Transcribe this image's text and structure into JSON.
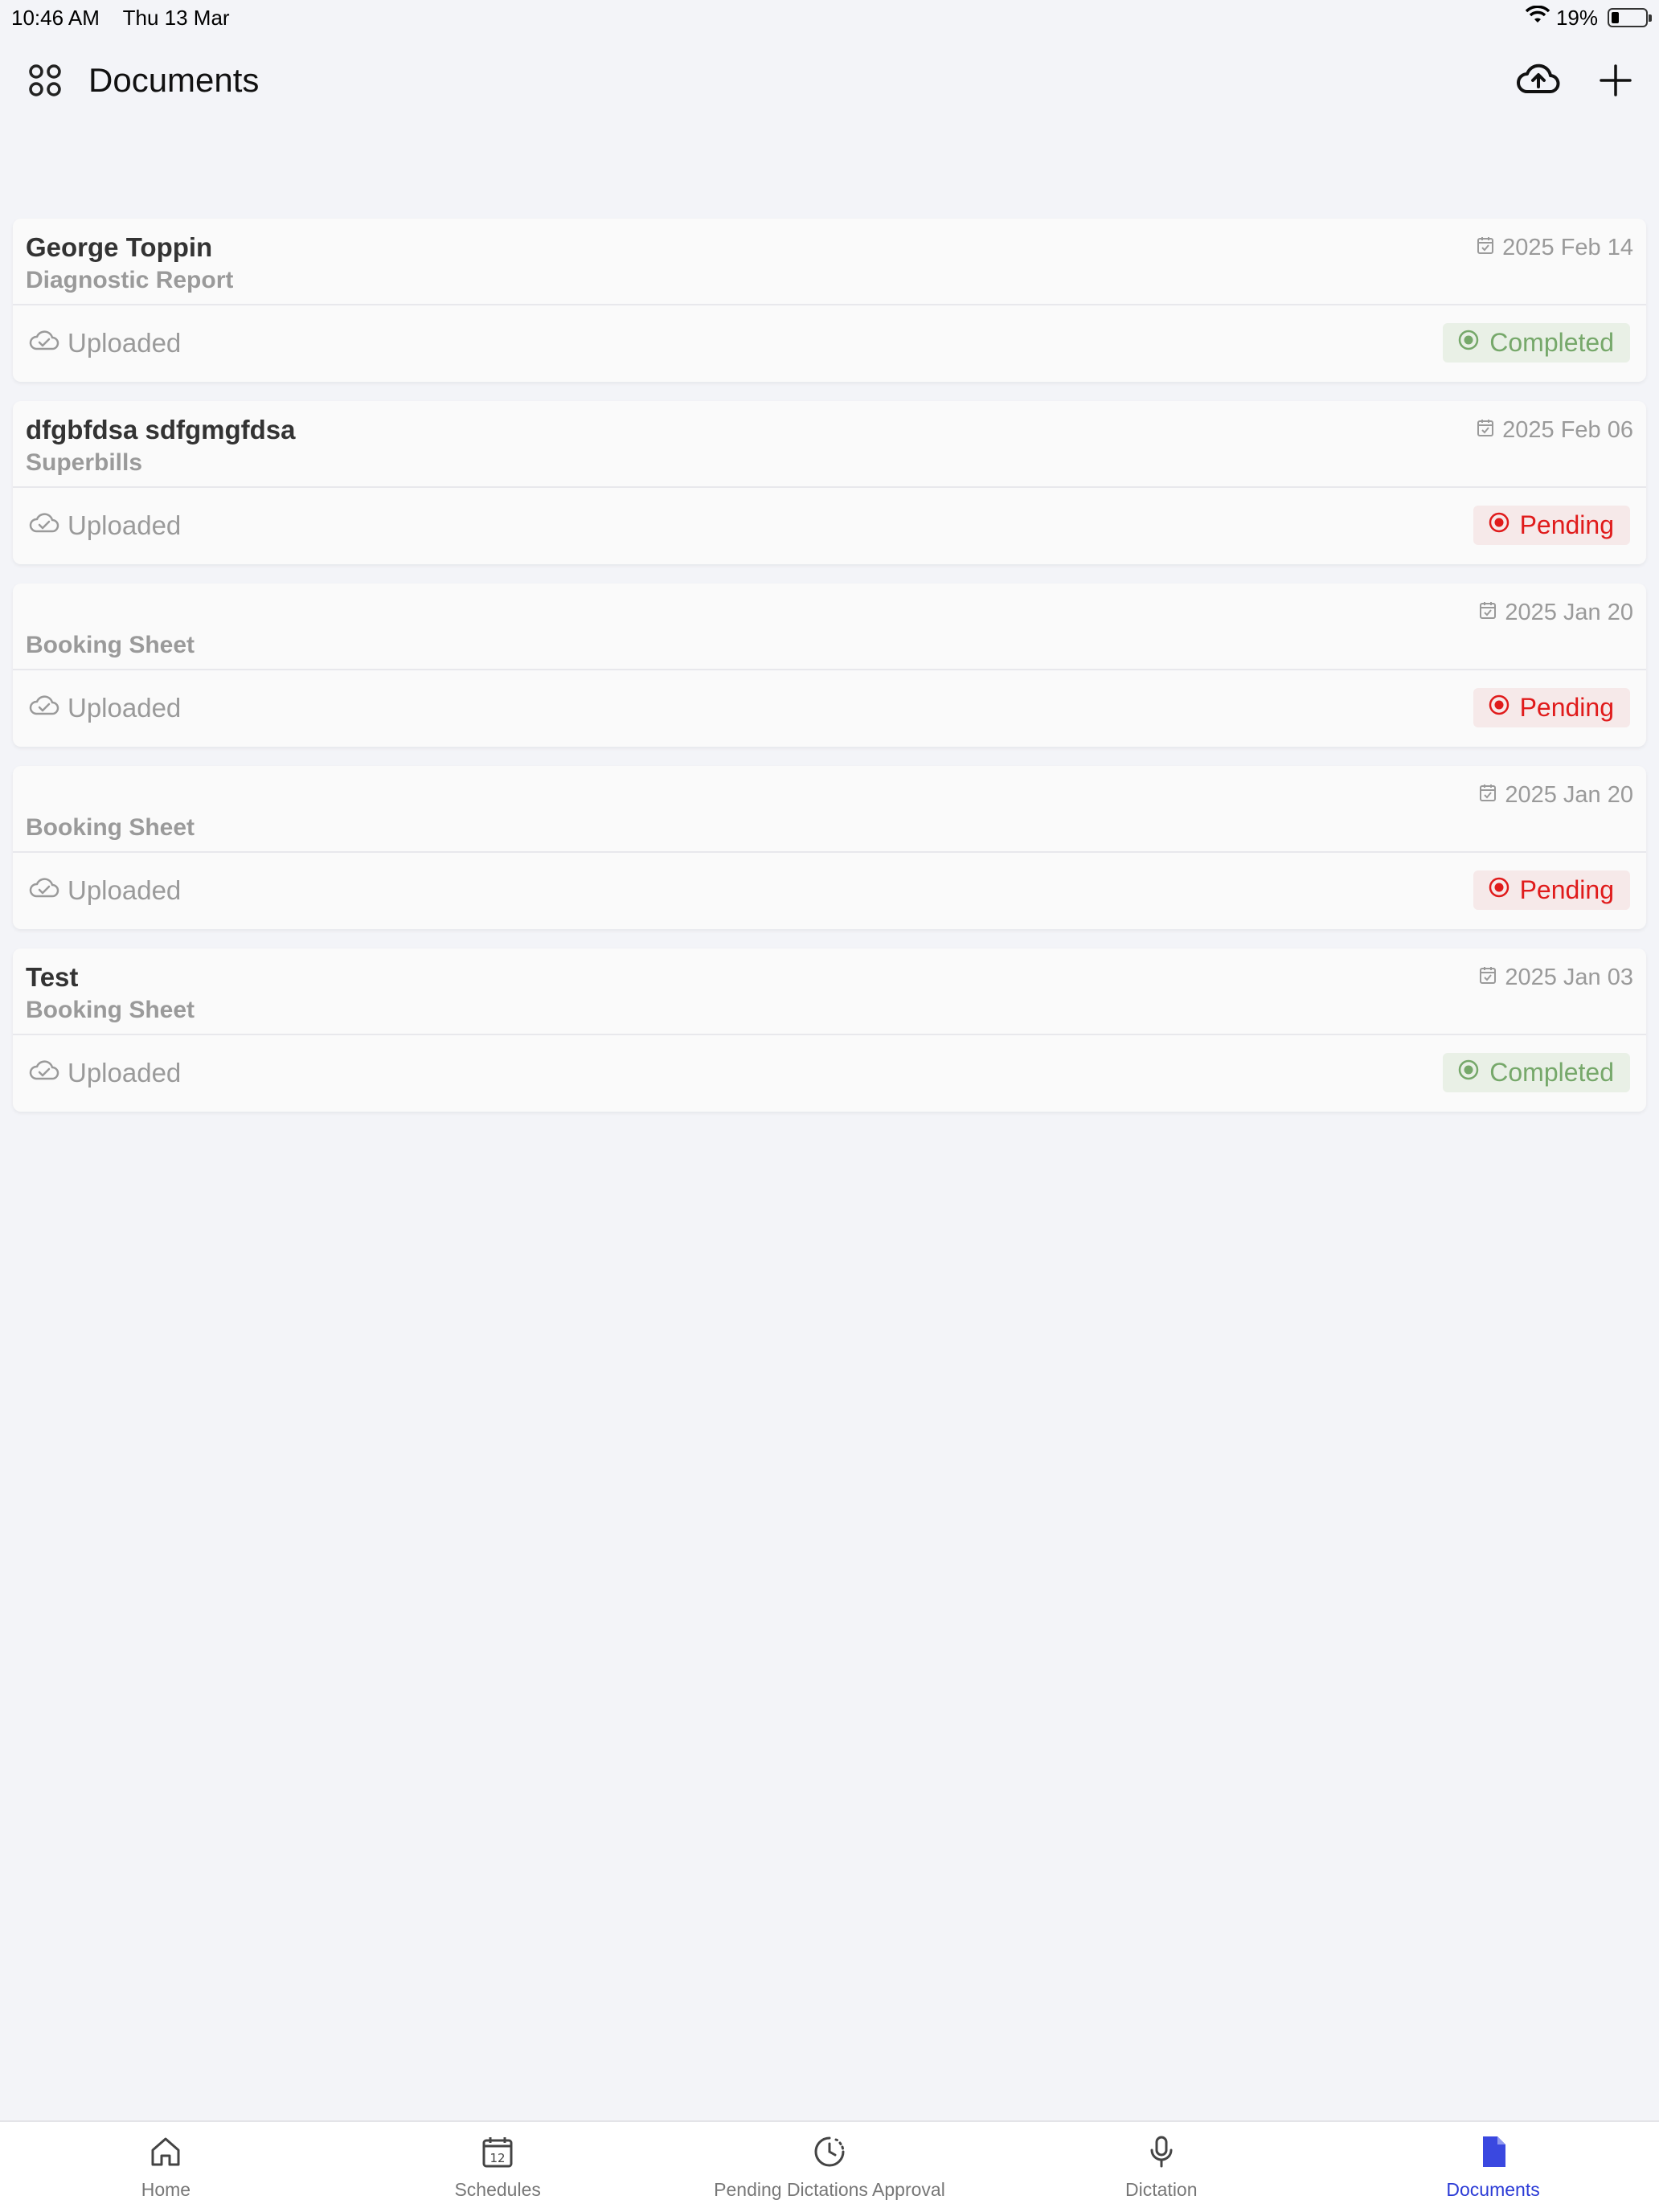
{
  "status": {
    "time": "10:46 AM",
    "date": "Thu 13 Mar",
    "battery": "19%"
  },
  "header": {
    "title": "Documents"
  },
  "documents": [
    {
      "name": "George Toppin",
      "type": "Diagnostic Report",
      "date": "2025 Feb 14",
      "upload_status": "Uploaded",
      "status": "Completed",
      "status_kind": "completed"
    },
    {
      "name": "dfgbfdsa sdfgmgfdsa",
      "type": "Superbills",
      "date": "2025 Feb 06",
      "upload_status": "Uploaded",
      "status": "Pending",
      "status_kind": "pending"
    },
    {
      "name": "",
      "type": "Booking Sheet",
      "date": "2025 Jan 20",
      "upload_status": "Uploaded",
      "status": "Pending",
      "status_kind": "pending"
    },
    {
      "name": "",
      "type": "Booking Sheet",
      "date": "2025 Jan 20",
      "upload_status": "Uploaded",
      "status": "Pending",
      "status_kind": "pending"
    },
    {
      "name": "Test",
      "type": "Booking Sheet",
      "date": "2025 Jan 03",
      "upload_status": "Uploaded",
      "status": "Completed",
      "status_kind": "completed"
    }
  ],
  "tabs": [
    {
      "label": "Home",
      "icon": "home-icon"
    },
    {
      "label": "Schedules",
      "icon": "calendar-icon"
    },
    {
      "label": "Pending Dictations Approval",
      "icon": "clock-icon"
    },
    {
      "label": "Dictation",
      "icon": "microphone-icon"
    },
    {
      "label": "Documents",
      "icon": "document-icon",
      "active": true
    }
  ],
  "colors": {
    "accent": "#2b3bd6",
    "completed": "#76a86a",
    "pending": "#e01b1b"
  }
}
